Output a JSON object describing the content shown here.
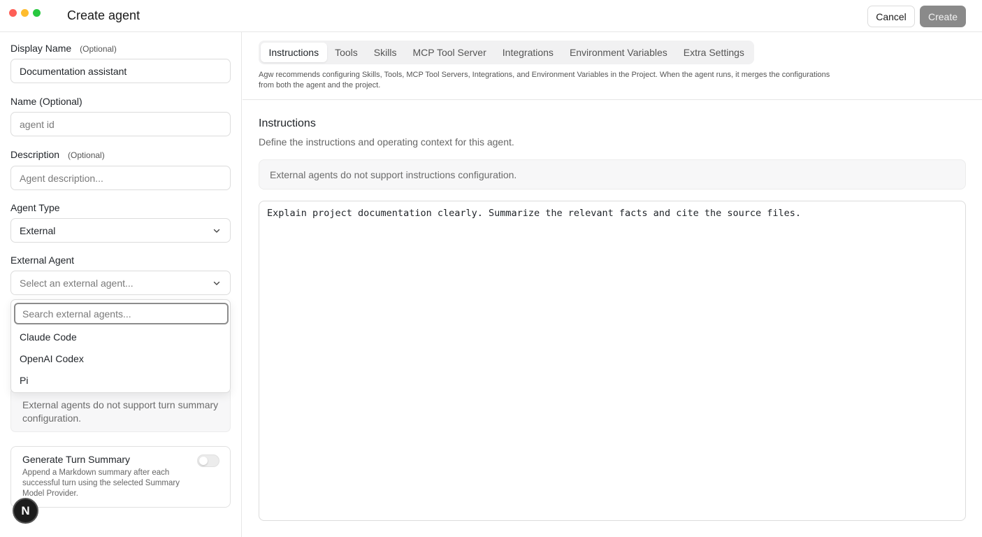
{
  "window": {
    "title": "Create agent",
    "cancel_label": "Cancel",
    "create_label": "Create"
  },
  "form": {
    "display_name": {
      "label": "Display Name",
      "optional": "(Optional)",
      "value": "Documentation assistant"
    },
    "name": {
      "label": "Name (Optional)",
      "placeholder": "agent id"
    },
    "description": {
      "label": "Description",
      "optional": "(Optional)",
      "placeholder": "Agent description..."
    },
    "agent_type": {
      "label": "Agent Type",
      "value": "External"
    },
    "external_agent": {
      "label": "External Agent",
      "placeholder": "Select an external agent...",
      "search_placeholder": "Search external agents...",
      "options": [
        "Claude Code",
        "OpenAI Codex",
        "Pi"
      ]
    },
    "turn_summary_note": "External agents do not support turn summary configuration.",
    "turn_summary": {
      "title": "Generate Turn Summary",
      "description": "Append a Markdown summary after each successful turn using the selected Summary Model Provider.",
      "enabled": false
    }
  },
  "badge": {
    "letter": "N"
  },
  "tabs": [
    {
      "label": "Instructions",
      "active": true
    },
    {
      "label": "Tools"
    },
    {
      "label": "Skills"
    },
    {
      "label": "MCP Tool Server"
    },
    {
      "label": "Integrations"
    },
    {
      "label": "Environment Variables"
    },
    {
      "label": "Extra Settings"
    }
  ],
  "notice": "Agw recommends configuring Skills, Tools, MCP Tool Servers, Integrations, and Environment Variables in the Project. When the agent runs, it merges the configurations from both the agent and the project.",
  "instructions": {
    "title": "Instructions",
    "description": "Define the instructions and operating context for this agent.",
    "info": "External agents do not support instructions configuration.",
    "content": "Explain project documentation clearly. Summarize the relevant facts and cite the source files."
  },
  "icons": {
    "select_chevron": "chevron-down-icon"
  }
}
